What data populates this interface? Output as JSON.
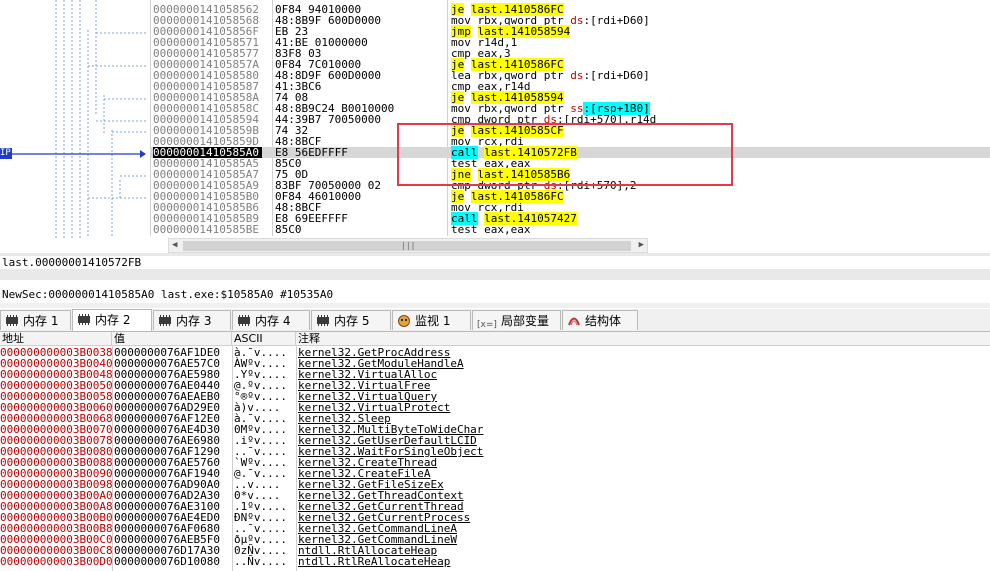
{
  "disasm": {
    "rip_label": "IP",
    "rows": [
      {
        "addr": "0000000141058562",
        "bytes": "0F84 94010000",
        "instr": [
          {
            "t": "je",
            "c": "y"
          },
          {
            "t": " "
          },
          {
            "t": "last.1410586FC",
            "c": "y"
          }
        ]
      },
      {
        "addr": "0000000141058568",
        "bytes": "48:8B9F 600D0000",
        "instr": [
          {
            "t": "mov rbx,qword ptr "
          },
          {
            "t": "ds",
            "c": "red"
          },
          {
            "t": ":[rdi+D60]"
          }
        ]
      },
      {
        "addr": "000000014105856F",
        "bytes": "EB 23",
        "instr": [
          {
            "t": "jmp",
            "c": "y"
          },
          {
            "t": " "
          },
          {
            "t": "last.141058594",
            "c": "y"
          }
        ]
      },
      {
        "addr": "0000000141058571",
        "bytes": "41:BE 01000000",
        "instr": [
          {
            "t": "mov r14d,1"
          }
        ]
      },
      {
        "addr": "0000000141058577",
        "bytes": "83F8 03",
        "instr": [
          {
            "t": "cmp eax,3"
          }
        ]
      },
      {
        "addr": "000000014105857A",
        "bytes": "0F84 7C010000",
        "instr": [
          {
            "t": "je",
            "c": "y"
          },
          {
            "t": " "
          },
          {
            "t": "last.1410586FC",
            "c": "y"
          }
        ]
      },
      {
        "addr": "0000000141058580",
        "bytes": "48:8D9F 600D0000",
        "instr": [
          {
            "t": "lea rbx,qword ptr "
          },
          {
            "t": "ds",
            "c": "red"
          },
          {
            "t": ":[rdi+D60]"
          }
        ]
      },
      {
        "addr": "0000000141058587",
        "bytes": "41:3BC6",
        "instr": [
          {
            "t": "cmp eax,r14d"
          }
        ]
      },
      {
        "addr": "000000014105858A",
        "bytes": "74 08",
        "instr": [
          {
            "t": "je",
            "c": "y"
          },
          {
            "t": " "
          },
          {
            "t": "last.141058594",
            "c": "y"
          }
        ]
      },
      {
        "addr": "000000014105858C",
        "bytes": "48:8B9C24 B0010000",
        "instr": [
          {
            "t": "mov rbx,qword ptr "
          },
          {
            "t": "ss",
            "c": "red"
          },
          {
            "t": ":[rsp+1B0]",
            "c": "c"
          }
        ]
      },
      {
        "addr": "0000000141058594",
        "bytes": "44:39B7 70050000",
        "instr": [
          {
            "t": "cmp dword ptr "
          },
          {
            "t": "ds",
            "c": "red"
          },
          {
            "t": ":[rdi+570],r14d"
          }
        ]
      },
      {
        "addr": "000000014105859B",
        "bytes": "74 32",
        "instr": [
          {
            "t": "je",
            "c": "y"
          },
          {
            "t": " "
          },
          {
            "t": "last.1410585CF",
            "c": "y"
          }
        ]
      },
      {
        "addr": "000000014105859D",
        "bytes": "48:8BCF",
        "instr": [
          {
            "t": "mov rcx,rdi"
          }
        ]
      },
      {
        "addr": "00000001410585A0",
        "bytes": "E8 56EDFFFF",
        "instr": [
          {
            "t": "call",
            "c": "c"
          },
          {
            "t": " "
          },
          {
            "t": "last.1410572FB",
            "c": "y"
          }
        ],
        "current": true
      },
      {
        "addr": "00000001410585A5",
        "bytes": "85C0",
        "instr": [
          {
            "t": "test eax,eax"
          }
        ]
      },
      {
        "addr": "00000001410585A7",
        "bytes": "75 0D",
        "instr": [
          {
            "t": "jne",
            "c": "y"
          },
          {
            "t": " "
          },
          {
            "t": "last.1410585B6",
            "c": "y"
          }
        ]
      },
      {
        "addr": "00000001410585A9",
        "bytes": "83BF 70050000 02",
        "instr": [
          {
            "t": "cmp dword ptr "
          },
          {
            "t": "ds",
            "c": "red"
          },
          {
            "t": ":[rdi+570],2"
          }
        ]
      },
      {
        "addr": "00000001410585B0",
        "bytes": "0F84 46010000",
        "instr": [
          {
            "t": "je",
            "c": "y"
          },
          {
            "t": " "
          },
          {
            "t": "last.1410586FC",
            "c": "y"
          }
        ]
      },
      {
        "addr": "00000001410585B6",
        "bytes": "48:8BCF",
        "instr": [
          {
            "t": "mov rcx,rdi"
          }
        ]
      },
      {
        "addr": "00000001410585B9",
        "bytes": "E8 69EEFFFF",
        "instr": [
          {
            "t": "call",
            "c": "c"
          },
          {
            "t": " "
          },
          {
            "t": "last.141057427",
            "c": "y"
          }
        ]
      },
      {
        "addr": "00000001410585BE",
        "bytes": "85C0",
        "instr": [
          {
            "t": "test eax,eax"
          }
        ]
      }
    ]
  },
  "info": {
    "line1": "last.00000001410572FB",
    "line2": "NewSec:00000001410585A0 last.exe:$10585A0 #10535A0"
  },
  "tabs": [
    {
      "label": "内存 1",
      "icon": "memory-icon"
    },
    {
      "label": "内存 2",
      "icon": "memory-icon",
      "active": true
    },
    {
      "label": "内存 3",
      "icon": "memory-icon"
    },
    {
      "label": "内存 4",
      "icon": "memory-icon"
    },
    {
      "label": "内存 5",
      "icon": "memory-icon"
    },
    {
      "label": "监视 1",
      "icon": "watch-icon"
    },
    {
      "label": "局部变量",
      "icon": "locals-icon",
      "icon_text": "[x=]"
    },
    {
      "label": "结构体",
      "icon": "struct-icon"
    }
  ],
  "dump": {
    "headers": [
      "地址",
      "值",
      "ASCII",
      "注释"
    ],
    "rows": [
      {
        "addr": "000000000003B0038",
        "val": "0000000076AF1DE0",
        "ascii": "à.¯v....",
        "cmt": "kernel32.GetProcAddress"
      },
      {
        "addr": "000000000003B0040",
        "val": "0000000076AE57C0",
        "ascii": "ÀWºv....",
        "cmt": "kernel32.GetModuleHandleA"
      },
      {
        "addr": "000000000003B0048",
        "val": "0000000076AE5980",
        "ascii": ".Yºv....",
        "cmt": "kernel32.VirtualAlloc"
      },
      {
        "addr": "000000000003B0050",
        "val": "0000000076AE0440",
        "ascii": "@.ºv....",
        "cmt": "kernel32.VirtualFree"
      },
      {
        "addr": "000000000003B0058",
        "val": "0000000076AEAEB0",
        "ascii": "°®ºv....",
        "cmt": "kernel32.VirtualQuery"
      },
      {
        "addr": "000000000003B0060",
        "val": "0000000076AD29E0",
        "ascii": "à)­v....",
        "cmt": "kernel32.VirtualProtect"
      },
      {
        "addr": "000000000003B0068",
        "val": "0000000076AF12E0",
        "ascii": "à.¯v....",
        "cmt": "kernel32.Sleep"
      },
      {
        "addr": "000000000003B0070",
        "val": "0000000076AE4D30",
        "ascii": "0Mºv....",
        "cmt": "kernel32.MultiByteToWideChar"
      },
      {
        "addr": "000000000003B0078",
        "val": "0000000076AE6980",
        "ascii": ".iºv....",
        "cmt": "kernel32.GetUserDefaultLCID"
      },
      {
        "addr": "000000000003B0080",
        "val": "0000000076AF1290",
        "ascii": "..¯v....",
        "cmt": "kernel32.WaitForSingleObject"
      },
      {
        "addr": "000000000003B0088",
        "val": "0000000076AE5760",
        "ascii": "`Wºv....",
        "cmt": "kernel32.CreateThread"
      },
      {
        "addr": "000000000003B0090",
        "val": "0000000076AF1940",
        "ascii": "@.¯v....",
        "cmt": "kernel32.CreateFileA"
      },
      {
        "addr": "000000000003B0098",
        "val": "0000000076AD90A0",
        "ascii": "..­v....",
        "cmt": "kernel32.GetFileSizeEx"
      },
      {
        "addr": "000000000003B00A0",
        "val": "0000000076AD2A30",
        "ascii": "0*­v....",
        "cmt": "kernel32.GetThreadContext"
      },
      {
        "addr": "000000000003B00A8",
        "val": "0000000076AE3100",
        "ascii": ".1ºv....",
        "cmt": "kernel32.GetCurrentThread"
      },
      {
        "addr": "000000000003B00B0",
        "val": "0000000076AE4ED0",
        "ascii": "ÐNºv....",
        "cmt": "kernel32.GetCurrentProcess"
      },
      {
        "addr": "000000000003B00B8",
        "val": "0000000076AF0680",
        "ascii": "..¯v....",
        "cmt": "kernel32.GetCommandLineA"
      },
      {
        "addr": "000000000003B00C0",
        "val": "0000000076AEB5F0",
        "ascii": "ðµºv....",
        "cmt": "kernel32.GetCommandLineW"
      },
      {
        "addr": "000000000003B00C8",
        "val": "0000000076D17A30",
        "ascii": "0zÑv....",
        "cmt": "ntdll.RtlAllocateHeap"
      },
      {
        "addr": "000000000003B00D0",
        "val": "0000000076D10080",
        "ascii": "..Ñv....",
        "cmt": "ntdll.RtlReAllocateHeap"
      }
    ]
  }
}
